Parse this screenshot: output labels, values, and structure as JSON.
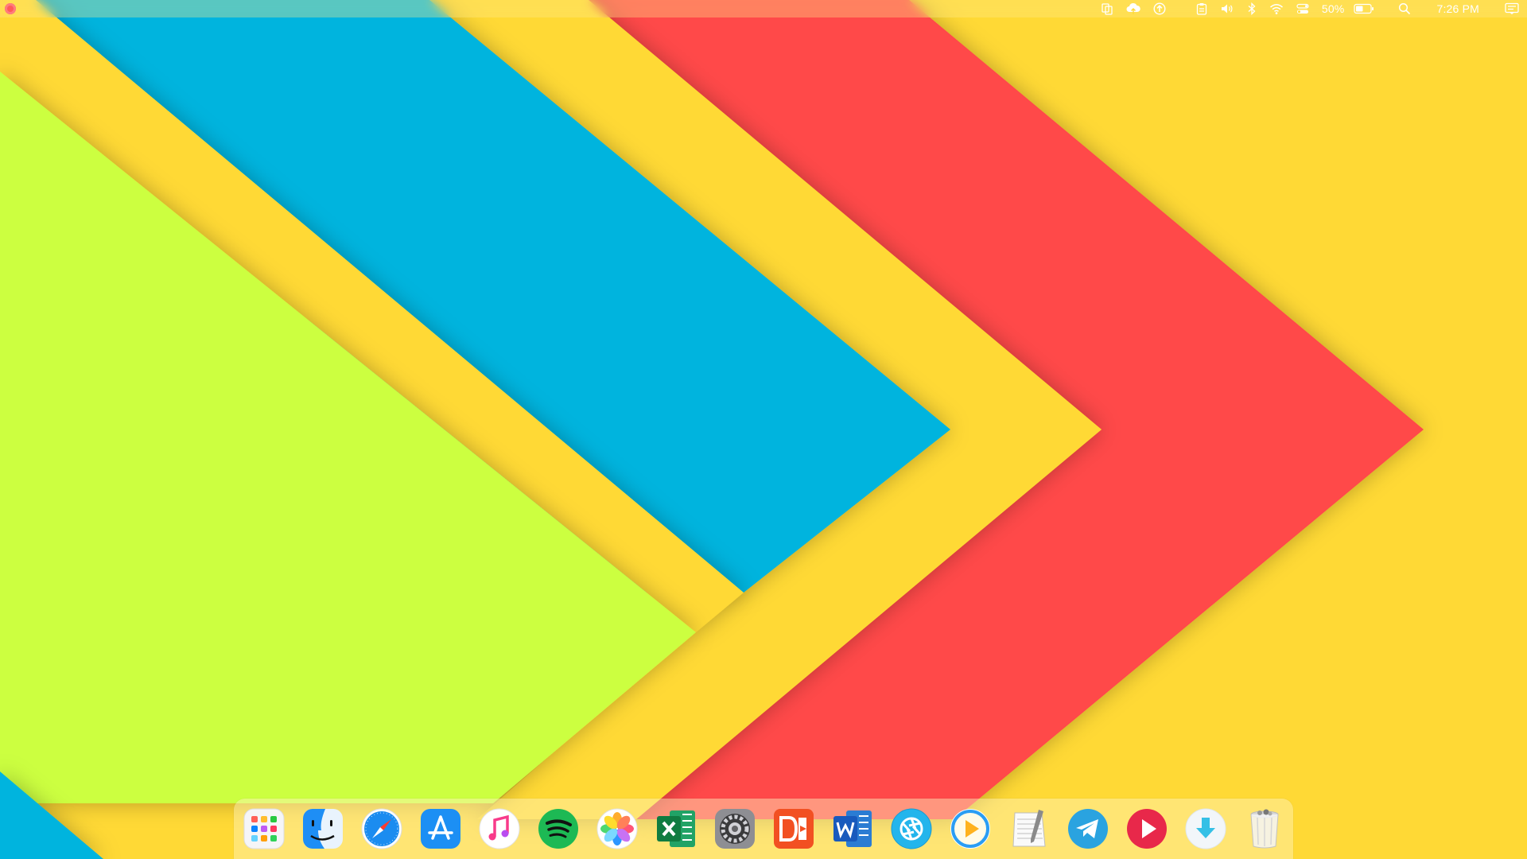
{
  "menubar": {
    "battery_percent": "50%",
    "clock": "7:26 PM",
    "status_icons": [
      "copy-icon",
      "cloud-upload-icon",
      "arrow-up-circle-icon",
      "clipboard-icon",
      "volume-icon",
      "bluetooth-icon",
      "wifi-icon",
      "control-center-icon",
      "battery-icon",
      "search-icon",
      "notification-center-icon"
    ]
  },
  "wallpaper_colors": {
    "lime": "#ccff40",
    "yellow": "#ffd935",
    "cyan": "#00b4de",
    "red": "#ff4848"
  },
  "dock": {
    "items": [
      {
        "name": "launchpad",
        "running": false
      },
      {
        "name": "finder",
        "running": true
      },
      {
        "name": "safari",
        "running": true
      },
      {
        "name": "app-store",
        "running": false
      },
      {
        "name": "music",
        "running": false
      },
      {
        "name": "spotify",
        "running": false
      },
      {
        "name": "photos",
        "running": false
      },
      {
        "name": "excel",
        "running": false
      },
      {
        "name": "system-preferences",
        "running": true
      },
      {
        "name": "office",
        "running": false
      },
      {
        "name": "word",
        "running": false
      },
      {
        "name": "shutter",
        "running": false
      },
      {
        "name": "infuse",
        "running": false
      },
      {
        "name": "text-edit",
        "running": false
      },
      {
        "name": "telegram",
        "running": false
      },
      {
        "name": "media-player",
        "running": true
      },
      {
        "name": "downloader",
        "running": false
      },
      {
        "name": "trash",
        "running": false
      }
    ]
  }
}
